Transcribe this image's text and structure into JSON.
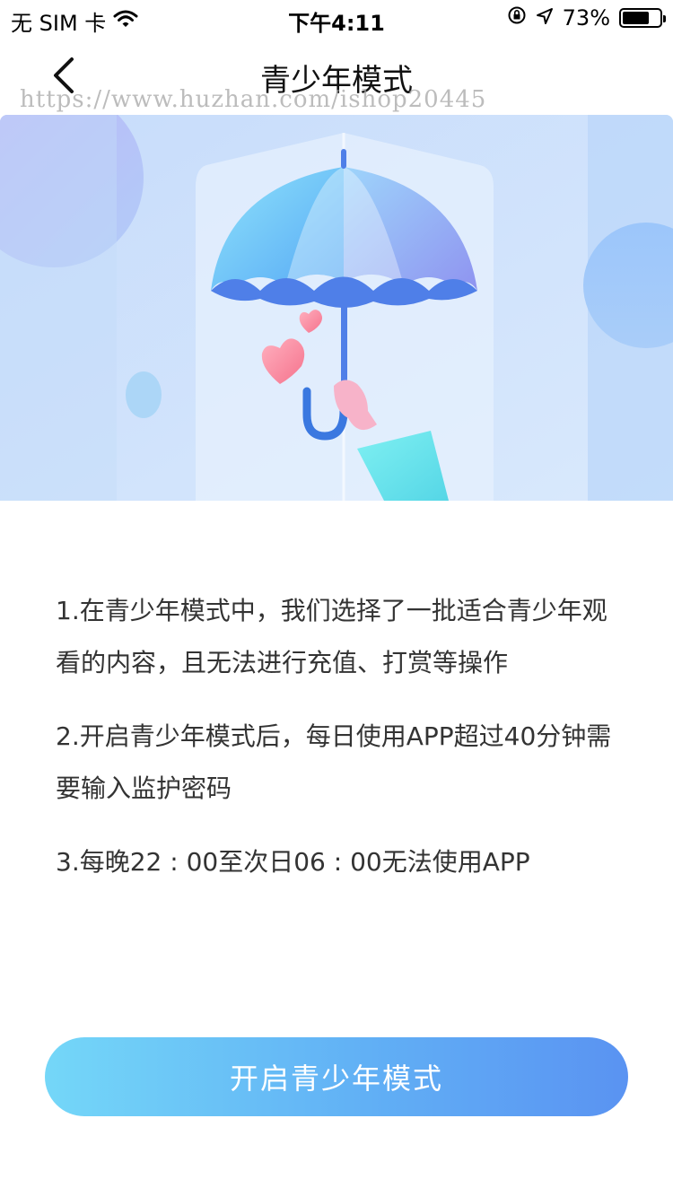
{
  "status_bar": {
    "carrier": "无 SIM 卡",
    "time": "下午4:11",
    "battery_percent": "73%",
    "battery_level": 0.73,
    "wifi_icon": "wifi-icon",
    "lock_icon": "orientation-lock-icon",
    "location_icon": "location-arrow-icon"
  },
  "nav": {
    "title": "青少年模式",
    "back_icon": "chevron-left-icon"
  },
  "watermark": "https://www.huzhan.com/ishop20445",
  "banner": {
    "illustration": "umbrella-hearts-illustration"
  },
  "rules": [
    "1.在青少年模式中，我们选择了一批适合青少年观看的内容，且无法进行充值、打赏等操作",
    "2.开启青少年模式后，每日使用APP超过40分钟需要输入监护密码",
    "3.每晚22 : 00至次日06 : 00无法使用APP"
  ],
  "cta": {
    "label": "开启青少年模式"
  },
  "colors": {
    "cta_start": "#74d7f8",
    "cta_end": "#5a93f2",
    "text": "#333333"
  }
}
